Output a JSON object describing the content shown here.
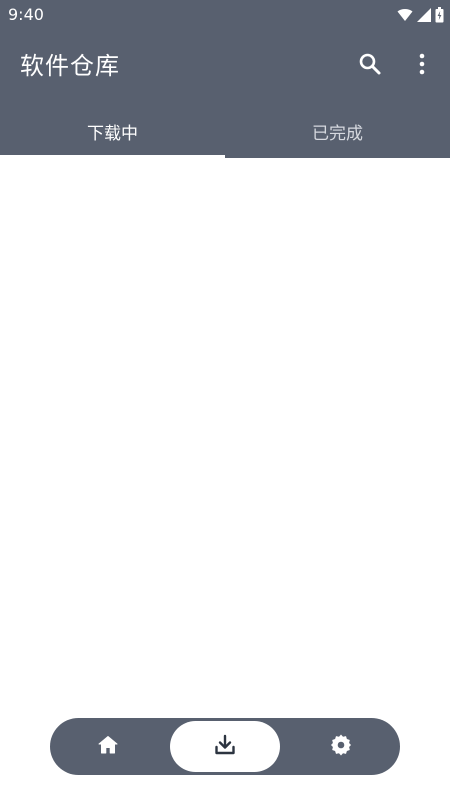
{
  "status_bar": {
    "time": "9:40",
    "icons": [
      "wifi-icon",
      "signal-icon",
      "battery-icon"
    ]
  },
  "toolbar": {
    "title": "软件仓库",
    "actions": [
      "search-icon",
      "more-vert-icon"
    ]
  },
  "tabs": [
    {
      "label": "下载中",
      "selected": true
    },
    {
      "label": "已完成",
      "selected": false
    }
  ],
  "bottom_nav": {
    "items": [
      {
        "icon": "home-icon",
        "selected": false
      },
      {
        "icon": "download-icon",
        "selected": true
      },
      {
        "icon": "settings-icon",
        "selected": false
      }
    ]
  },
  "colors": {
    "primary": "#58606f",
    "on_primary": "#ffffff",
    "tab_inactive": "#d6d9df",
    "background": "#ffffff",
    "selected_icon": "#2c3440"
  }
}
